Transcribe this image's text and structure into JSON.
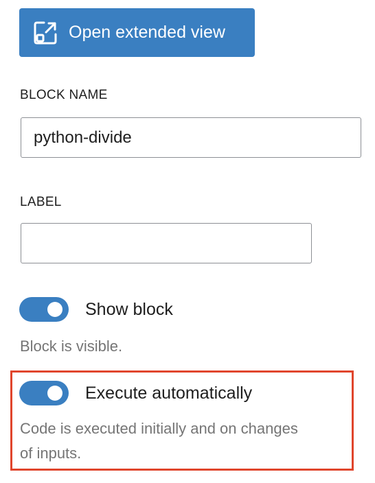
{
  "toolbar": {
    "open_extended_view_label": "Open extended view"
  },
  "block_name": {
    "label": "BLOCK NAME",
    "value": "python-divide"
  },
  "label_field": {
    "label": "LABEL",
    "value": ""
  },
  "show_block": {
    "label": "Show block",
    "enabled": true,
    "help": "Block is visible."
  },
  "execute_auto": {
    "label": "Execute automatically",
    "enabled": true,
    "help_line1": "Code is executed initially and on changes",
    "help_line2": "of inputs."
  },
  "colors": {
    "accent": "#3a7fc1",
    "highlight": "#e0452c",
    "help_text": "#757575"
  },
  "icons": {
    "extended_view": "open-external-icon"
  }
}
